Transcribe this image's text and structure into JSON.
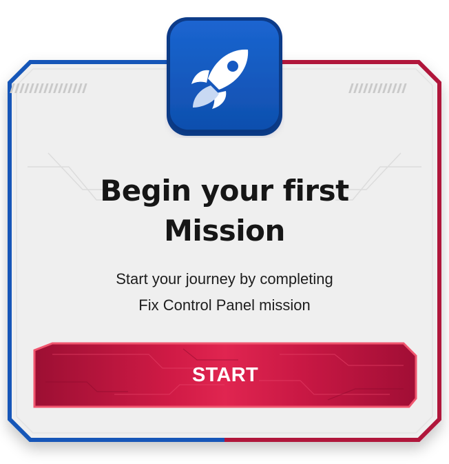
{
  "mission_card": {
    "title_line1": "Begin your first",
    "title_line2": "Mission",
    "subtitle_line1": "Start your journey by completing",
    "subtitle_line2": "Fix Control Panel mission",
    "start_button_label": "START",
    "icon": "rocket-icon"
  },
  "colors": {
    "frame_blue": "#1257b8",
    "frame_red": "#b0123a",
    "panel_bg": "#efefef",
    "icon_tile": "#1559c2",
    "button_red": "#c8163f",
    "button_border": "#f0566f"
  }
}
